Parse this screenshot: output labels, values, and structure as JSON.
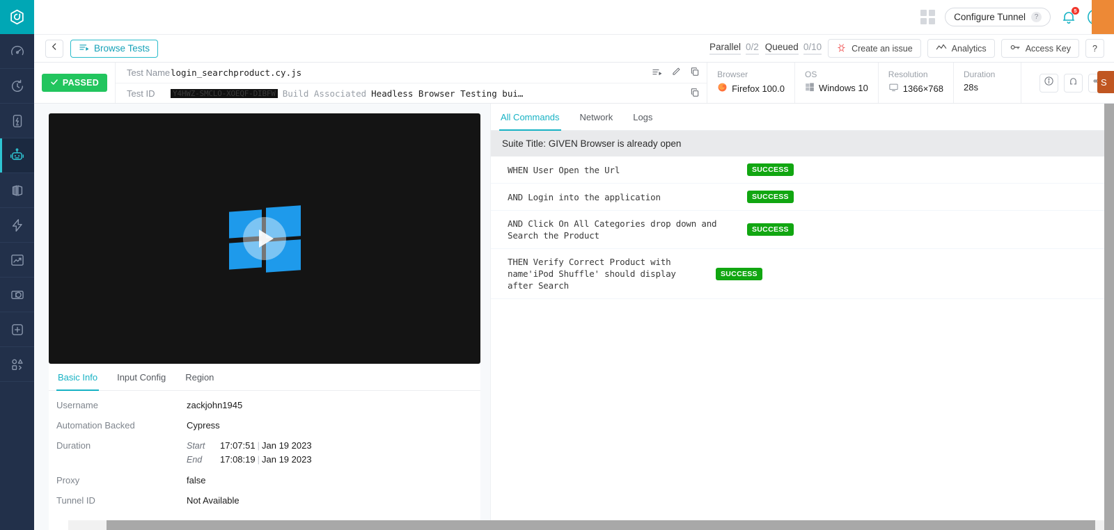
{
  "rail": {
    "logo": "lambdatest-logo",
    "items": [
      {
        "name": "dashboard-speedometer",
        "icon": "speedometer-icon",
        "active": false
      },
      {
        "name": "timeline",
        "icon": "clock-arrow-icon",
        "active": false
      },
      {
        "name": "real-time-testing",
        "icon": "device-bolt-icon",
        "active": false
      },
      {
        "name": "automation",
        "icon": "robot-icon",
        "active": true
      },
      {
        "name": "visual-regression",
        "icon": "split-screen-icon",
        "active": false
      },
      {
        "name": "hyperexecute",
        "icon": "lightning-icon",
        "active": false
      },
      {
        "name": "analytics",
        "icon": "chart-trend-icon",
        "active": false
      },
      {
        "name": "smart-ui",
        "icon": "contrast-circle-icon",
        "active": false
      },
      {
        "name": "integrations",
        "icon": "plus-square-icon",
        "active": false
      },
      {
        "name": "developer-api",
        "icon": "shapes-code-icon",
        "active": false
      }
    ]
  },
  "header": {
    "grid_icon": "grid-icon",
    "configure_tunnel": "Configure Tunnel",
    "tunnel_help": "?",
    "bell_icon": "bell-icon",
    "bell_badge": "5",
    "avatar_icon": "user-avatar-icon"
  },
  "toolbar": {
    "back_icon": "chevron-left-icon",
    "browse_tests": "Browse Tests",
    "browse_icon": "list-play-icon",
    "parallel_label": "Parallel",
    "parallel_value": "0/2",
    "queued_label": "Queued",
    "queued_value": "0/10",
    "create_issue": "Create an issue",
    "create_issue_icon": "bug-icon",
    "analytics": "Analytics",
    "analytics_icon": "line-chart-icon",
    "access_key": "Access Key",
    "access_key_icon": "key-icon",
    "help": "?"
  },
  "infobar": {
    "status": "PASSED",
    "status_icon": "check-icon",
    "test_name_label": "Test Name",
    "test_name_value": "login_searchproduct.cy.js",
    "test_id_label": "Test ID",
    "test_id_value": "Y4HWZ-SMCLO-XOEQF-DIBFW",
    "build_label": "Build Associated",
    "build_value": "Headless Browser Testing bui…",
    "row_icons": [
      "list-play-icon",
      "pencil-icon",
      "copy-icon"
    ],
    "testid_copy_icon": "copy-icon",
    "specs": [
      {
        "key": "Browser",
        "value": "Firefox 100.0",
        "icon": "firefox-icon"
      },
      {
        "key": "OS",
        "value": "Windows 10",
        "icon": "windows-icon"
      },
      {
        "key": "Resolution",
        "value": "1366×768",
        "icon": "monitor-icon"
      },
      {
        "key": "Duration",
        "value": "28s",
        "icon": ""
      }
    ],
    "actions": [
      "info-circle-icon",
      "magnet-icon",
      "share-icon"
    ]
  },
  "video": {
    "poster": "windows-logo",
    "play_button": "play-icon"
  },
  "info_panel": {
    "tabs": [
      {
        "label": "Basic Info",
        "active": true
      },
      {
        "label": "Input Config",
        "active": false
      },
      {
        "label": "Region",
        "active": false
      }
    ],
    "rows": [
      {
        "key": "Username",
        "value": "zackjohn1945"
      },
      {
        "key": "Automation Backed",
        "value": "Cypress"
      }
    ],
    "duration": {
      "key": "Duration",
      "start_label": "Start",
      "start_value": "17:07:51",
      "start_date": "Jan 19 2023",
      "end_label": "End",
      "end_value": "17:08:19",
      "end_date": "Jan 19 2023"
    },
    "rows2": [
      {
        "key": "Proxy",
        "value": "false"
      },
      {
        "key": "Tunnel ID",
        "value": "Not Available"
      }
    ]
  },
  "commands": {
    "tabs": [
      {
        "label": "All Commands",
        "active": true
      },
      {
        "label": "Network",
        "active": false
      },
      {
        "label": "Logs",
        "active": false
      }
    ],
    "suite_title": "Suite Title: GIVEN Browser is already open",
    "rows": [
      {
        "text": "WHEN User Open the Url",
        "status": "SUCCESS"
      },
      {
        "text": "AND Login into the application",
        "status": "SUCCESS"
      },
      {
        "text": "AND Click On All Categories drop down and Search the Product",
        "status": "SUCCESS"
      },
      {
        "text": "THEN Verify Correct Product with name'iPod Shuffle' should display after Search",
        "status": "SUCCESS"
      }
    ]
  },
  "colors": {
    "accent": "#17b2c4",
    "success": "#11a611",
    "passed": "#22c55e",
    "rail_bg": "#22304a",
    "logo_bg": "#00a7b5",
    "orange": "#ed8936"
  }
}
